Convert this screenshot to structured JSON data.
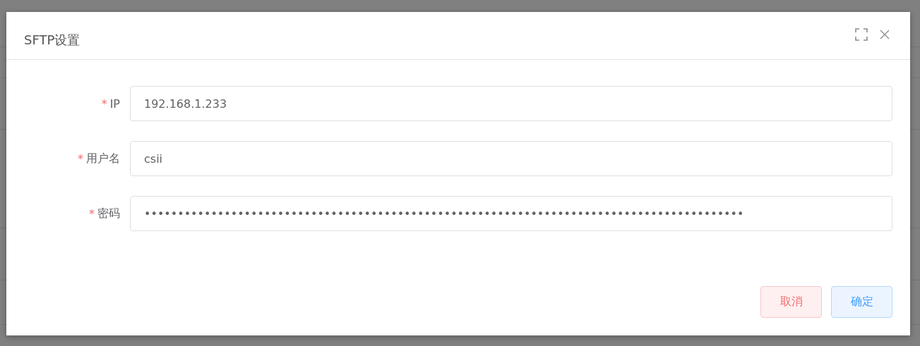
{
  "dialog": {
    "title": "SFTP设置",
    "fields": [
      {
        "label": "IP",
        "required_mark": "*",
        "value": "192.168.1.233"
      },
      {
        "label": "用户名",
        "required_mark": "*",
        "value": "csii"
      },
      {
        "label": "密码",
        "required_mark": "*",
        "value": "••••••••••••••••••••••••••••••••••••••••••••••••••••••••••••••••••••••••••••••••••••••••••"
      }
    ],
    "buttons": [
      {
        "label": "取消",
        "kind": "danger"
      },
      {
        "label": "确定",
        "kind": "primary"
      }
    ]
  }
}
